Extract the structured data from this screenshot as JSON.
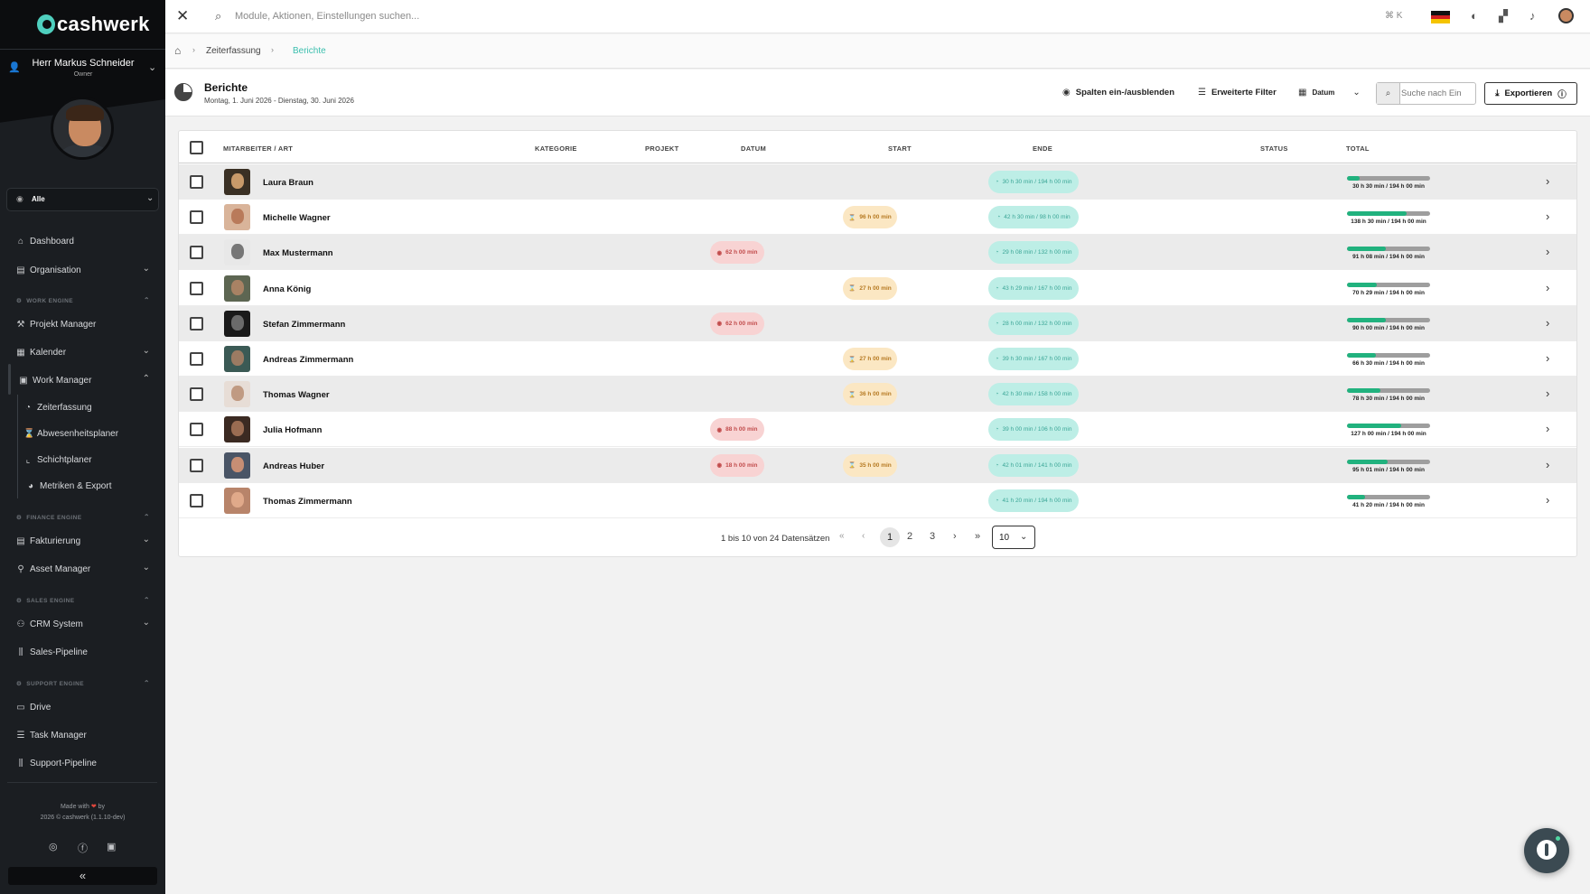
{
  "app": {
    "logo_text": "cashwerk",
    "brand_color": "#4fcfbe"
  },
  "user": {
    "name": "Herr Markus Schneider",
    "role": "Owner"
  },
  "scope_filter": {
    "value": "Alle"
  },
  "nav": {
    "dashboard": "Dashboard",
    "organisation": "Organisation",
    "work_engine": "WORK ENGINE",
    "projekt_manager": "Projekt Manager",
    "kalender": "Kalender",
    "work_manager": "Work Manager",
    "zeiterfassung": "Zeiterfassung",
    "abwesenheitsplaner": "Abwesenheitsplaner",
    "schichtplaner": "Schichtplaner",
    "metriken_export": "Metriken & Export",
    "finance_engine": "FINANCE ENGINE",
    "fakturierung": "Fakturierung",
    "asset_manager": "Asset Manager",
    "sales_engine": "SALES ENGINE",
    "crm_system": "CRM System",
    "sales_pipeline": "Sales-Pipeline",
    "support_engine": "SUPPORT ENGINE",
    "drive": "Drive",
    "task_manager": "Task Manager",
    "support_pipeline": "Support-Pipeline"
  },
  "footer": {
    "made_with": "Made with",
    "by": "by",
    "copyright": "2026 © cashwerk (1.1.10-dev)"
  },
  "topbar": {
    "search_placeholder": "Module, Aktionen, Einstellungen suchen...",
    "shortcut": "⌘ K"
  },
  "breadcrumb": {
    "item1": "Zeiterfassung",
    "item2": "Berichte"
  },
  "header": {
    "title": "Berichte",
    "subtitle": "Montag, 1. Juni 2026 - Dienstag, 30. Juni 2026",
    "columns_toggle": "Spalten ein-/ausblenden",
    "advanced_filter": "Erweiterte Filter",
    "date_select": "Datum",
    "search_placeholder": "Suche nach Ein",
    "export": "Exportieren"
  },
  "table": {
    "headers": {
      "employee": "MITARBEITER / ART",
      "category": "KATEGORIE",
      "project": "PROJEKT",
      "date": "DATUM",
      "start": "START",
      "end": "ENDE",
      "status": "STATUS",
      "total": "TOTAL"
    },
    "rows": [
      {
        "name": "Laura Braun",
        "datum": "",
        "start": "",
        "ende": "30 h 30 min / 194 h 00 min",
        "total": "30 h 30 min / 194 h 00 min",
        "progress": 0.157
      },
      {
        "name": "Michelle Wagner",
        "datum": "",
        "start": "96 h 00 min",
        "ende": "42 h 30 min / 98 h 00 min",
        "total": "138 h 30 min / 194 h 00 min",
        "progress": 0.714
      },
      {
        "name": "Max Mustermann",
        "datum": "62 h 00 min",
        "start": "",
        "ende": "29 h 08 min / 132 h 00 min",
        "total": "91 h 08 min / 194 h 00 min",
        "progress": 0.47
      },
      {
        "name": "Anna König",
        "datum": "",
        "start": "27 h 00 min",
        "ende": "43 h 29 min / 167 h 00 min",
        "total": "70 h 29 min / 194 h 00 min",
        "progress": 0.363
      },
      {
        "name": "Stefan Zimmermann",
        "datum": "62 h 00 min",
        "start": "",
        "ende": "28 h 00 min / 132 h 00 min",
        "total": "90 h 00 min / 194 h 00 min",
        "progress": 0.464
      },
      {
        "name": "Andreas Zimmermann",
        "datum": "",
        "start": "27 h 00 min",
        "ende": "39 h 30 min / 167 h 00 min",
        "total": "66 h 30 min / 194 h 00 min",
        "progress": 0.343
      },
      {
        "name": "Thomas Wagner",
        "datum": "",
        "start": "36 h 00 min",
        "ende": "42 h 30 min / 158 h 00 min",
        "total": "78 h 30 min / 194 h 00 min",
        "progress": 0.405
      },
      {
        "name": "Julia Hofmann",
        "datum": "88 h 00 min",
        "start": "",
        "ende": "39 h 00 min / 106 h 00 min",
        "total": "127 h 00 min / 194 h 00 min",
        "progress": 0.655
      },
      {
        "name": "Andreas Huber",
        "datum": "18 h 00 min",
        "start": "35 h 00 min",
        "ende": "42 h 01 min / 141 h 00 min",
        "total": "95 h 01 min / 194 h 00 min",
        "progress": 0.49
      },
      {
        "name": "Thomas Zimmermann",
        "datum": "",
        "start": "",
        "ende": "41 h 20 min / 194 h 00 min",
        "total": "41 h 20 min / 194 h 00 min",
        "progress": 0.213
      }
    ]
  },
  "pagination": {
    "info": "1 bis 10 von 24 Datensätzen",
    "pages": [
      "1",
      "2",
      "3"
    ],
    "page_size": "10"
  }
}
